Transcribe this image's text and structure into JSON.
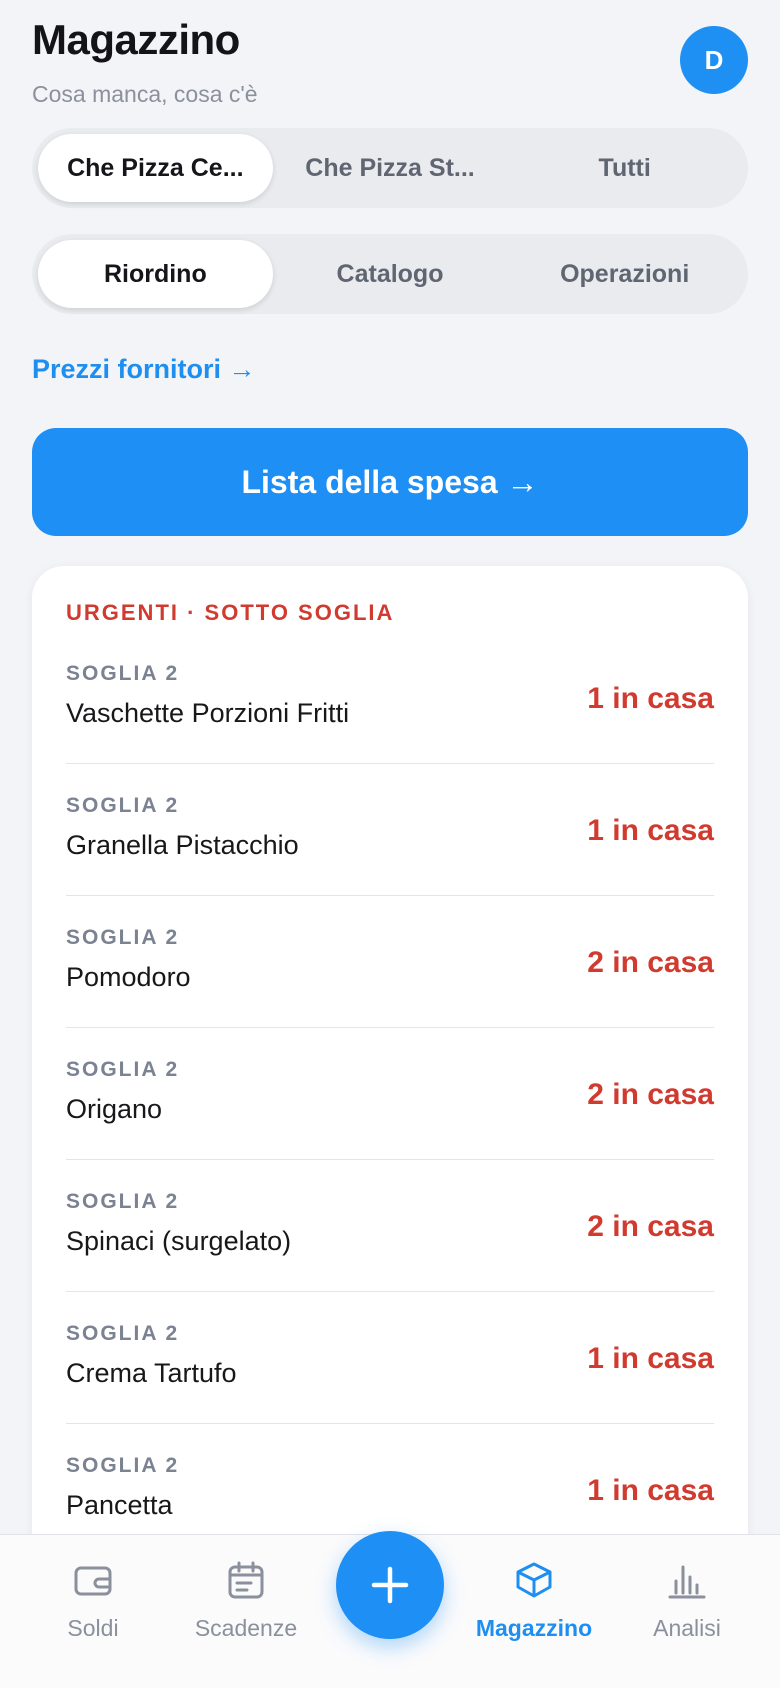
{
  "header": {
    "title": "Magazzino",
    "subtitle": "Cosa manca, cosa c'è",
    "avatar_initial": "D"
  },
  "store_tabs": [
    {
      "label": "Che Pizza Ce...",
      "active": true
    },
    {
      "label": "Che Pizza St...",
      "active": false
    },
    {
      "label": "Tutti",
      "active": false
    }
  ],
  "section_tabs": [
    {
      "label": "Riordino",
      "active": true
    },
    {
      "label": "Catalogo",
      "active": false
    },
    {
      "label": "Operazioni",
      "active": false
    }
  ],
  "supplier_prices_link": "Prezzi fornitori →",
  "shopping_list_button": "Lista della spesa →",
  "urgent": {
    "heading": "URGENTI · SOTTO SOGLIA",
    "items": [
      {
        "threshold": "SOGLIA 2",
        "name": "Vaschette Porzioni Fritti",
        "stock": "1 in casa"
      },
      {
        "threshold": "SOGLIA 2",
        "name": "Granella Pistacchio",
        "stock": "1 in casa"
      },
      {
        "threshold": "SOGLIA 2",
        "name": "Pomodoro",
        "stock": "2 in casa"
      },
      {
        "threshold": "SOGLIA 2",
        "name": "Origano",
        "stock": "2 in casa"
      },
      {
        "threshold": "SOGLIA 2",
        "name": "Spinaci (surgelato)",
        "stock": "2 in casa"
      },
      {
        "threshold": "SOGLIA 2",
        "name": "Crema Tartufo",
        "stock": "1 in casa"
      },
      {
        "threshold": "SOGLIA 2",
        "name": "Pancetta",
        "stock": "1 in casa"
      }
    ]
  },
  "tabbar": {
    "soldi": "Soldi",
    "scadenze": "Scadenze",
    "magazzino": "Magazzino",
    "analisi": "Analisi",
    "fab_icon": "plus-icon"
  },
  "colors": {
    "accent": "#1e8ff4",
    "urgent": "#d13a2f",
    "background": "#f3f4f7"
  }
}
